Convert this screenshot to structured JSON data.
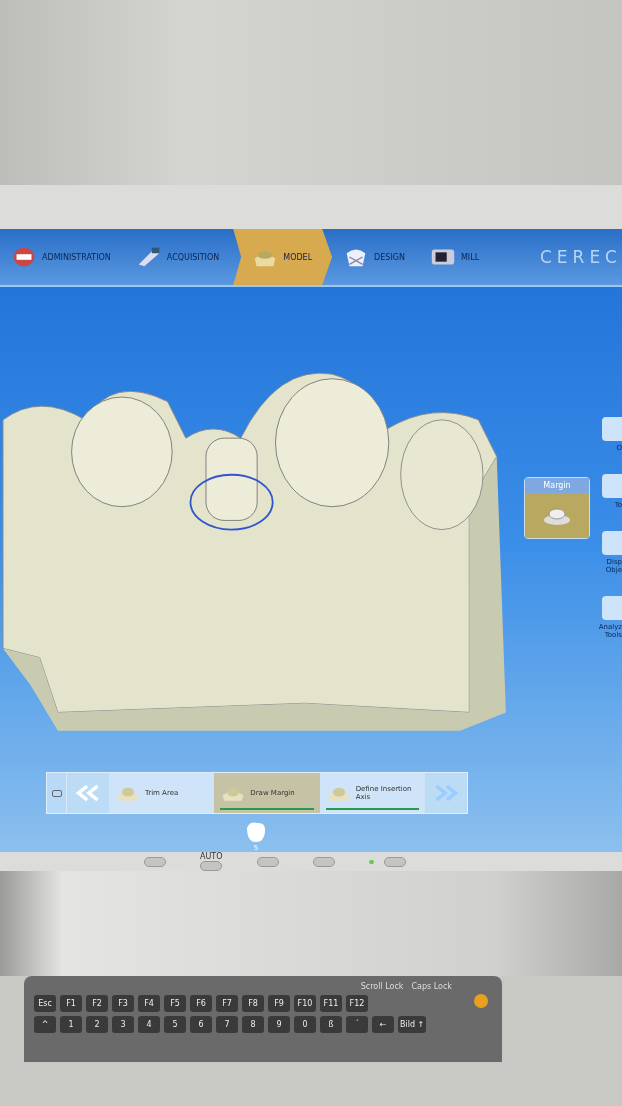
{
  "nav": {
    "steps": [
      {
        "label": "ADMINISTRATION",
        "selected": false
      },
      {
        "label": "ACQUISITION",
        "selected": false
      },
      {
        "label": "MODEL",
        "selected": true
      },
      {
        "label": "DESIGN",
        "selected": false
      },
      {
        "label": "MILL",
        "selected": false
      }
    ],
    "brand": "CEREC"
  },
  "margin_popup": {
    "title": "Margin"
  },
  "side_tools": [
    {
      "label": "O"
    },
    {
      "label": "To"
    },
    {
      "label": "Disp Obje"
    },
    {
      "label": "Analyz Tools"
    }
  ],
  "step_bar": {
    "steps": [
      {
        "label": "Trim Area",
        "selected": false,
        "done": false
      },
      {
        "label": "Draw Margin",
        "selected": true,
        "done": true
      },
      {
        "label": "Define Insertion Axis",
        "selected": false,
        "done": true
      }
    ]
  },
  "tooth_selector": {
    "label": "5"
  },
  "monitor": {
    "auto_label": "AUTO"
  },
  "keyboard": {
    "indicators": [
      "Scroll Lock",
      "Caps Lock"
    ],
    "rows": [
      [
        "Esc",
        "F1",
        "F2",
        "F3",
        "F4",
        "F5",
        "F6",
        "F7",
        "F8",
        "F9",
        "F10",
        "F11",
        "F12"
      ],
      [
        "^",
        "1",
        "2",
        "3",
        "4",
        "5",
        "6",
        "7",
        "8",
        "9",
        "0",
        "ß",
        "´",
        "←",
        "Bild ↑"
      ]
    ]
  }
}
